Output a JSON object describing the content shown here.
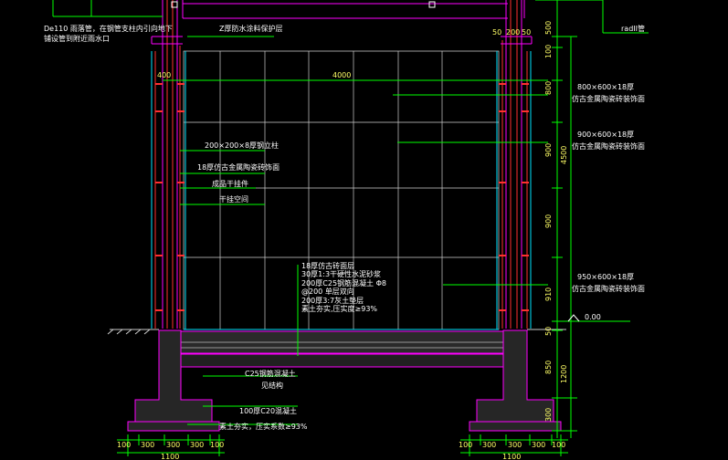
{
  "colors": {
    "background": "#000000",
    "wall": "#ff00ff",
    "inner_wall": "#ff3030",
    "tile_grid": "#d0d0d0",
    "leader": "#00ff00",
    "dim_text": "#ffff66",
    "note_text": "#ffffff",
    "cyan": "#00e5ff"
  },
  "top_notes": {
    "drain_note_1": "De110 雨落管，在钢管支柱内引向地下",
    "drain_note_2": "铺设管到附近雨水口",
    "top_finish": "Z厚防水涂料保护层",
    "right_top": "radII管"
  },
  "dims_top": {
    "left_400": "400",
    "width_4000": "4000",
    "right_50": "50",
    "right_200": "200",
    "right_50b": "50"
  },
  "right_callouts": {
    "tile_1_size": "800×600×18厚",
    "tile_1_name": "仿古金属陶瓷砖装饰面",
    "tile_2_size": "900×600×18厚",
    "tile_2_name": "仿古金属陶瓷砖装饰面",
    "tile_3_size": "950×600×18厚",
    "tile_3_name": "仿古金属陶瓷砖装饰面"
  },
  "left_callouts": {
    "steel_tube": "200×200×8厚钢立柱",
    "ceramic_face": "18厚仿古金属陶瓷砖饰面",
    "dry_hang": "成品干挂件",
    "dry_gap": "干挂空间"
  },
  "floor_layers": {
    "l1": "18厚仿古砖面层",
    "l2": "30厚1:3干硬性水泥砂浆",
    "l3": "200厚C25钢筋混凝土 Φ8",
    "l4": "@200 单层双向",
    "l5": "200厚3:7灰土垫层",
    "l6": "素土夯实,压实度≥93%"
  },
  "foundation_notes": {
    "c25": "C25钢筋混凝土",
    "c25_sub": "见结构",
    "c20": "100厚C20混凝土",
    "soil": "素土夯实，压实系数≥93%"
  },
  "vertical_dims": {
    "v500": "500",
    "v100": "100",
    "v800": "800",
    "v900a": "900",
    "v900b": "900",
    "v900c": "900",
    "v910": "910",
    "v4500": "4500",
    "v50": "50",
    "v850": "850",
    "v1200": "1200",
    "v300": "300"
  },
  "level_mark": "0.00",
  "bottom_dims_left": [
    "100",
    "300",
    "300",
    "300",
    "100"
  ],
  "bottom_total_left": "1100",
  "bottom_dims_right": [
    "100",
    "300",
    "300",
    "300",
    "100"
  ],
  "bottom_total_right": "1100"
}
